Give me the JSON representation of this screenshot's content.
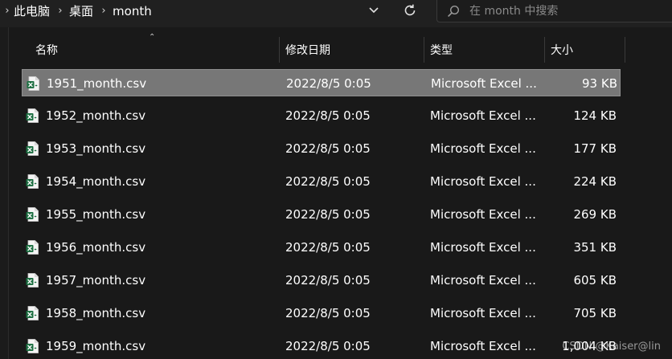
{
  "address_bar": {
    "crumbs": [
      "此电脑",
      "桌面",
      "month"
    ]
  },
  "search": {
    "placeholder": "在 month 中搜索"
  },
  "columns": {
    "name": "名称",
    "date": "修改日期",
    "type": "类型",
    "size": "大小"
  },
  "files": [
    {
      "name": "1951_month.csv",
      "date": "2022/8/5 0:05",
      "type": "Microsoft Excel ...",
      "size": "93 KB",
      "selected": true
    },
    {
      "name": "1952_month.csv",
      "date": "2022/8/5 0:05",
      "type": "Microsoft Excel ...",
      "size": "124 KB"
    },
    {
      "name": "1953_month.csv",
      "date": "2022/8/5 0:05",
      "type": "Microsoft Excel ...",
      "size": "177 KB"
    },
    {
      "name": "1954_month.csv",
      "date": "2022/8/5 0:05",
      "type": "Microsoft Excel ...",
      "size": "224 KB"
    },
    {
      "name": "1955_month.csv",
      "date": "2022/8/5 0:05",
      "type": "Microsoft Excel ...",
      "size": "269 KB"
    },
    {
      "name": "1956_month.csv",
      "date": "2022/8/5 0:05",
      "type": "Microsoft Excel ...",
      "size": "351 KB"
    },
    {
      "name": "1957_month.csv",
      "date": "2022/8/5 0:05",
      "type": "Microsoft Excel ...",
      "size": "605 KB"
    },
    {
      "name": "1958_month.csv",
      "date": "2022/8/5 0:05",
      "type": "Microsoft Excel ...",
      "size": "705 KB"
    },
    {
      "name": "1959_month.csv",
      "date": "2022/8/5 0:05",
      "type": "Microsoft Excel ...",
      "size": "1,004 KB"
    }
  ],
  "watermark": "CSDN @Kaiser@lin",
  "icons": {
    "file": "excel-csv-file-icon",
    "search": "search-icon",
    "refresh": "refresh-icon",
    "history": "chevron-down-icon",
    "separator": "chevron-right-icon",
    "sort": "sort-ascending-icon"
  },
  "colors": {
    "background": "#191919",
    "selection": "#777777",
    "excel_green": "#1D6F42"
  }
}
